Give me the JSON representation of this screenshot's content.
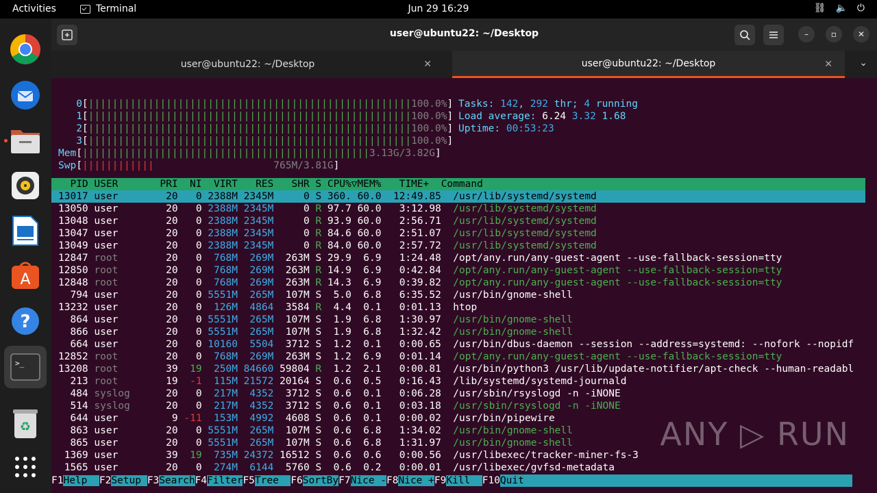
{
  "topbar": {
    "activities": "Activities",
    "app": "Terminal",
    "clock": "Jun 29  16:29"
  },
  "window": {
    "title": "user@ubuntu22: ~/Desktop",
    "tabs": [
      "user@ubuntu22: ~/Desktop",
      "user@ubuntu22: ~/Desktop"
    ]
  },
  "htop": {
    "cpus": [
      {
        "id": "0",
        "bar": "||||||||||||||||||||||||||||||||||||||||||||||||||||||",
        "pct": "100.0%"
      },
      {
        "id": "1",
        "bar": "||||||||||||||||||||||||||||||||||||||||||||||||||||||",
        "pct": "100.0%"
      },
      {
        "id": "2",
        "bar": "||||||||||||||||||||||||||||||||||||||||||||||||||||||",
        "pct": "100.0%"
      },
      {
        "id": "3",
        "bar": "||||||||||||||||||||||||||||||||||||||||||||||||||||||",
        "pct": "100.0%"
      }
    ],
    "mem": {
      "bar": "||||||||||||||||||||||||||||||||||||||||||||||||",
      "val": "3.13G/3.82G"
    },
    "swp": {
      "bar": "||||||||||||",
      "val": "765M/3.81G"
    },
    "tasks": {
      "label": "Tasks: ",
      "n": "142",
      "sep": ", ",
      "thr": "292",
      "thrlbl": " thr; ",
      "run": "4",
      "runlbl": " running"
    },
    "load": {
      "label": "Load average: ",
      "a": "6.24",
      "b": "3.32",
      "c": "1.68"
    },
    "uptime": {
      "label": "Uptime: ",
      "val": "00:53:23"
    },
    "header": "  PID USER       PRI  NI  VIRT   RES   SHR S CPU%▽MEM%   TIME+  Command",
    "rows": [
      {
        "pid": "13017",
        "user": "user",
        "pri": "20",
        "ni": "0",
        "virt": "2388M",
        "res": "2345M",
        "shr": "0",
        "s": "S",
        "cpu": "360.",
        "mem": "60.0",
        "time": "12:49.85",
        "cmd": "/usr/lib/systemd/systemd",
        "sel": true
      },
      {
        "pid": "13050",
        "user": "user",
        "pri": "20",
        "ni": "0",
        "virt": "2388M",
        "res": "2345M",
        "shr": "0",
        "s": "R",
        "cpu": "97.7",
        "mem": "60.0",
        "time": "3:12.98",
        "cmd": "/usr/lib/systemd/systemd",
        "thread": true
      },
      {
        "pid": "13048",
        "user": "user",
        "pri": "20",
        "ni": "0",
        "virt": "2388M",
        "res": "2345M",
        "shr": "0",
        "s": "R",
        "cpu": "93.9",
        "mem": "60.0",
        "time": "2:56.71",
        "cmd": "/usr/lib/systemd/systemd",
        "thread": true
      },
      {
        "pid": "13047",
        "user": "user",
        "pri": "20",
        "ni": "0",
        "virt": "2388M",
        "res": "2345M",
        "shr": "0",
        "s": "R",
        "cpu": "84.6",
        "mem": "60.0",
        "time": "2:51.07",
        "cmd": "/usr/lib/systemd/systemd",
        "thread": true
      },
      {
        "pid": "13049",
        "user": "user",
        "pri": "20",
        "ni": "0",
        "virt": "2388M",
        "res": "2345M",
        "shr": "0",
        "s": "R",
        "cpu": "84.0",
        "mem": "60.0",
        "time": "2:57.72",
        "cmd": "/usr/lib/systemd/systemd",
        "thread": true
      },
      {
        "pid": "12847",
        "user": "root",
        "pri": "20",
        "ni": "0",
        "virt": "768M",
        "res": "269M",
        "shr": "263M",
        "s": "S",
        "cpu": "29.9",
        "mem": "6.9",
        "time": "1:24.48",
        "cmd": "/opt/any.run/any-guest-agent --use-fallback-session=tty"
      },
      {
        "pid": "12850",
        "user": "root",
        "pri": "20",
        "ni": "0",
        "virt": "768M",
        "res": "269M",
        "shr": "263M",
        "s": "R",
        "cpu": "14.9",
        "mem": "6.9",
        "time": "0:42.84",
        "cmd": "/opt/any.run/any-guest-agent --use-fallback-session=tty",
        "thread": true
      },
      {
        "pid": "12848",
        "user": "root",
        "pri": "20",
        "ni": "0",
        "virt": "768M",
        "res": "269M",
        "shr": "263M",
        "s": "R",
        "cpu": "14.3",
        "mem": "6.9",
        "time": "0:39.82",
        "cmd": "/opt/any.run/any-guest-agent --use-fallback-session=tty",
        "thread": true
      },
      {
        "pid": "794",
        "user": "user",
        "pri": "20",
        "ni": "0",
        "virt": "5551M",
        "res": "265M",
        "shr": "107M",
        "s": "S",
        "cpu": "5.0",
        "mem": "6.8",
        "time": "6:35.52",
        "cmd": "/usr/bin/gnome-shell"
      },
      {
        "pid": "13232",
        "user": "user",
        "pri": "20",
        "ni": "0",
        "virt": "126M",
        "res": "4864",
        "shr": "3584",
        "s": "R",
        "cpu": "4.4",
        "mem": "0.1",
        "time": "0:01.13",
        "cmd": "htop"
      },
      {
        "pid": "864",
        "user": "user",
        "pri": "20",
        "ni": "0",
        "virt": "5551M",
        "res": "265M",
        "shr": "107M",
        "s": "S",
        "cpu": "1.9",
        "mem": "6.8",
        "time": "1:30.97",
        "cmd": "/usr/bin/gnome-shell",
        "thread": true
      },
      {
        "pid": "866",
        "user": "user",
        "pri": "20",
        "ni": "0",
        "virt": "5551M",
        "res": "265M",
        "shr": "107M",
        "s": "S",
        "cpu": "1.9",
        "mem": "6.8",
        "time": "1:32.42",
        "cmd": "/usr/bin/gnome-shell",
        "thread": true
      },
      {
        "pid": "664",
        "user": "user",
        "pri": "20",
        "ni": "0",
        "virt": "10160",
        "res": "5504",
        "shr": "3712",
        "s": "S",
        "cpu": "1.2",
        "mem": "0.1",
        "time": "0:00.65",
        "cmd": "/usr/bin/dbus-daemon --session --address=systemd: --nofork --nopidf"
      },
      {
        "pid": "12852",
        "user": "root",
        "pri": "20",
        "ni": "0",
        "virt": "768M",
        "res": "269M",
        "shr": "263M",
        "s": "S",
        "cpu": "1.2",
        "mem": "6.9",
        "time": "0:01.14",
        "cmd": "/opt/any.run/any-guest-agent --use-fallback-session=tty",
        "thread": true
      },
      {
        "pid": "13208",
        "user": "root",
        "pri": "39",
        "ni": "19",
        "virt": "250M",
        "res": "84660",
        "shr": "59804",
        "s": "R",
        "cpu": "1.2",
        "mem": "2.1",
        "time": "0:00.81",
        "cmd": "/usr/bin/python3 /usr/lib/update-notifier/apt-check --human-readabl"
      },
      {
        "pid": "213",
        "user": "root",
        "pri": "19",
        "ni": "-1",
        "virt": "115M",
        "res": "21572",
        "shr": "20164",
        "s": "S",
        "cpu": "0.6",
        "mem": "0.5",
        "time": "0:16.43",
        "cmd": "/lib/systemd/systemd-journald"
      },
      {
        "pid": "484",
        "user": "syslog",
        "pri": "20",
        "ni": "0",
        "virt": "217M",
        "res": "4352",
        "shr": "3712",
        "s": "S",
        "cpu": "0.6",
        "mem": "0.1",
        "time": "0:06.28",
        "cmd": "/usr/sbin/rsyslogd -n -iNONE"
      },
      {
        "pid": "514",
        "user": "syslog",
        "pri": "20",
        "ni": "0",
        "virt": "217M",
        "res": "4352",
        "shr": "3712",
        "s": "S",
        "cpu": "0.6",
        "mem": "0.1",
        "time": "0:03.18",
        "cmd": "/usr/sbin/rsyslogd -n -iNONE",
        "thread": true
      },
      {
        "pid": "644",
        "user": "user",
        "pri": "9",
        "ni": "-11",
        "virt": "153M",
        "res": "4992",
        "shr": "4608",
        "s": "S",
        "cpu": "0.6",
        "mem": "0.1",
        "time": "0:00.02",
        "cmd": "/usr/bin/pipewire"
      },
      {
        "pid": "863",
        "user": "user",
        "pri": "20",
        "ni": "0",
        "virt": "5551M",
        "res": "265M",
        "shr": "107M",
        "s": "S",
        "cpu": "0.6",
        "mem": "6.8",
        "time": "1:34.02",
        "cmd": "/usr/bin/gnome-shell",
        "thread": true
      },
      {
        "pid": "865",
        "user": "user",
        "pri": "20",
        "ni": "0",
        "virt": "5551M",
        "res": "265M",
        "shr": "107M",
        "s": "S",
        "cpu": "0.6",
        "mem": "6.8",
        "time": "1:31.97",
        "cmd": "/usr/bin/gnome-shell",
        "thread": true
      },
      {
        "pid": "1369",
        "user": "user",
        "pri": "39",
        "ni": "19",
        "virt": "735M",
        "res": "24372",
        "shr": "16512",
        "s": "S",
        "cpu": "0.6",
        "mem": "0.6",
        "time": "0:00.56",
        "cmd": "/usr/libexec/tracker-miner-fs-3"
      },
      {
        "pid": "1565",
        "user": "user",
        "pri": "20",
        "ni": "0",
        "virt": "274M",
        "res": "6144",
        "shr": "5760",
        "s": "S",
        "cpu": "0.6",
        "mem": "0.2",
        "time": "0:00.01",
        "cmd": "/usr/libexec/gvfsd-metadata"
      }
    ],
    "fkeys": [
      {
        "k": "F1",
        "l": "Help  "
      },
      {
        "k": "F2",
        "l": "Setup "
      },
      {
        "k": "F3",
        "l": "Search"
      },
      {
        "k": "F4",
        "l": "Filter"
      },
      {
        "k": "F5",
        "l": "Tree  "
      },
      {
        "k": "F6",
        "l": "SortBy"
      },
      {
        "k": "F7",
        "l": "Nice -"
      },
      {
        "k": "F8",
        "l": "Nice +"
      },
      {
        "k": "F9",
        "l": "Kill  "
      },
      {
        "k": "F10",
        "l": "Quit"
      }
    ]
  },
  "watermark": "ANY ▷ RUN",
  "colors": {
    "terminal_bg": "#300a24",
    "header_bg": "#26a269",
    "selected_bg": "#2aa1b3",
    "accent": "#e95420"
  }
}
